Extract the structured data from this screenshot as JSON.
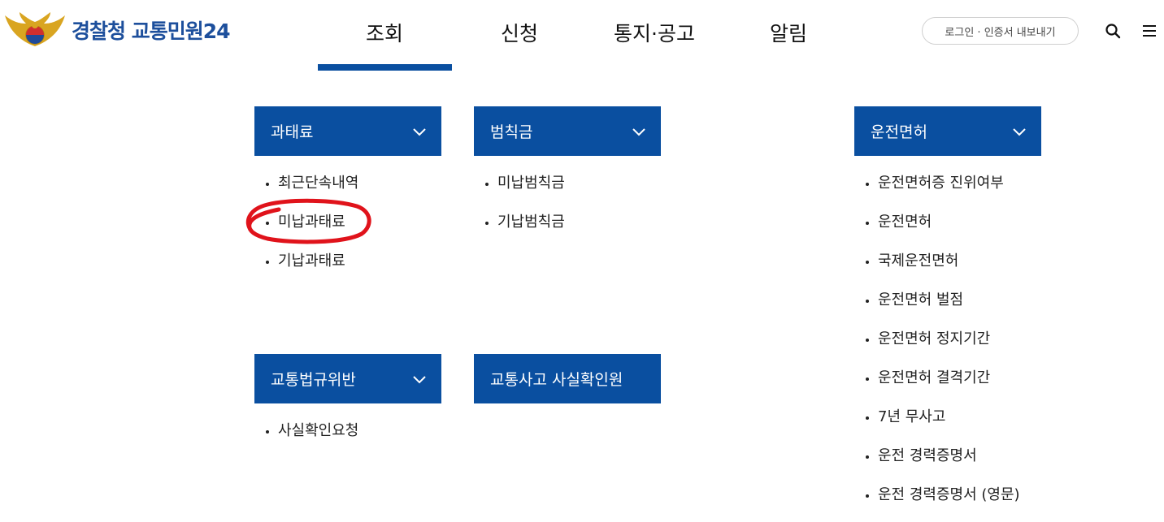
{
  "header": {
    "logo_text": "경찰청 교통민원24",
    "nav": [
      "조회",
      "신청",
      "통지·공고",
      "알림"
    ],
    "active_nav": "조회",
    "login_label": "로그인 · 인증서 내보내기",
    "search_icon": "search-icon",
    "menu_icon": "hamburger-menu-icon"
  },
  "groups": [
    {
      "title": "과태료",
      "items": [
        "최근단속내역",
        "미납과태료",
        "기납과태료"
      ]
    },
    {
      "title": "범칙금",
      "items": [
        "미납범칙금",
        "기납범칙금"
      ]
    },
    {
      "title": "운전면허",
      "items": [
        "운전면허증 진위여부",
        "운전면허",
        "국제운전면허",
        "운전면허 벌점",
        "운전면허 정지기간",
        "운전면허 결격기간",
        "7년 무사고",
        "운전 경력증명서",
        "운전 경력증명서 (영문)"
      ]
    },
    {
      "title": "교통법규위반",
      "items": [
        "사실확인요청"
      ]
    },
    {
      "title": "교통사고 사실확인원",
      "items": []
    }
  ],
  "colors": {
    "brand": "#0a4fa0",
    "logo": "#1d4f9c",
    "highlight": "#e0131b"
  }
}
